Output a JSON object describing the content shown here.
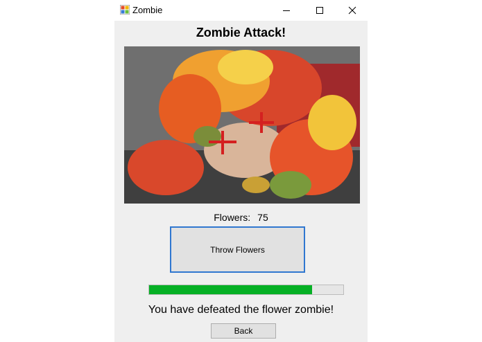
{
  "window": {
    "title": "Zombie",
    "controls": {
      "minimize_icon": "minimize-icon",
      "maximize_icon": "maximize-icon",
      "close_icon": "close-icon"
    }
  },
  "main": {
    "heading": "Zombie Attack!",
    "image": {
      "subject": "face-covered-with-flowers"
    },
    "flowers_label": "Flowers:",
    "flowers_count": "75",
    "throw_button": "Throw Flowers",
    "progress": {
      "value_percent": 84
    },
    "message": "You have defeated the flower zombie!",
    "back_button": "Back"
  },
  "colors": {
    "progress_fill": "#06b025",
    "focus_border": "#2f77d0",
    "client_bg": "#efefef"
  }
}
